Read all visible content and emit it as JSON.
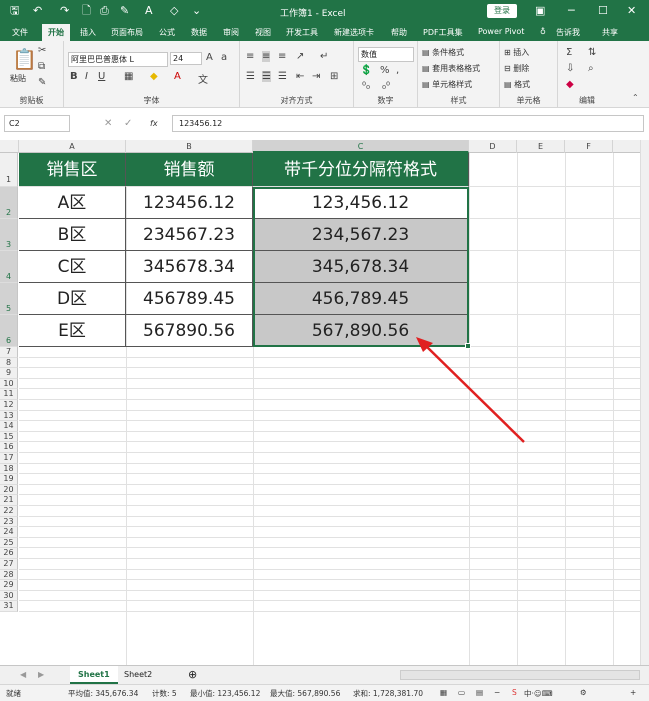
{
  "titlebar": {
    "title": "工作簿1 - Excel",
    "login": "登录"
  },
  "tabs": [
    "文件",
    "开始",
    "插入",
    "页面布局",
    "公式",
    "数据",
    "审阅",
    "视图",
    "开发工具",
    "新建选项卡",
    "帮助",
    "PDF工具集",
    "Power Pivot",
    "告诉我",
    "共享"
  ],
  "ribbon": {
    "clipboard": {
      "label": "剪贴板",
      "paste": "粘贴"
    },
    "font": {
      "label": "字体",
      "name": "阿里巴巴普惠体 L",
      "size": "24"
    },
    "align": {
      "label": "对齐方式"
    },
    "number": {
      "label": "数字",
      "format": "数值"
    },
    "styles": {
      "label": "样式",
      "cond": "条件格式",
      "table": "套用表格格式",
      "cell": "单元格样式"
    },
    "cells": {
      "label": "单元格",
      "insert": "插入",
      "delete": "删除",
      "format": "格式"
    },
    "edit": {
      "label": "编辑"
    }
  },
  "formula": {
    "namebox": "C2",
    "fx": "fx",
    "value": "123456.12"
  },
  "columns": [
    "A",
    "B",
    "C",
    "D",
    "E",
    "F"
  ],
  "table": {
    "headers": [
      "销售区",
      "销售额",
      "带千分位分隔符格式"
    ],
    "rows": [
      [
        "A区",
        "123456.12",
        "123,456.12"
      ],
      [
        "B区",
        "234567.23",
        "234,567.23"
      ],
      [
        "C区",
        "345678.34",
        "345,678.34"
      ],
      [
        "D区",
        "456789.45",
        "456,789.45"
      ],
      [
        "E区",
        "567890.56",
        "567,890.56"
      ]
    ]
  },
  "sheets": [
    "Sheet1",
    "Sheet2"
  ],
  "status": {
    "ready": "就绪",
    "avg": "平均值: 345,676.34",
    "count": "计数: 5",
    "min": "最小值: 123,456.12",
    "max": "最大值: 567,890.56",
    "sum": "求和: 1,728,381.70"
  },
  "colors": {
    "accent": "#217346",
    "highlight": "#c8c8c8",
    "arrow": "#e02020"
  }
}
